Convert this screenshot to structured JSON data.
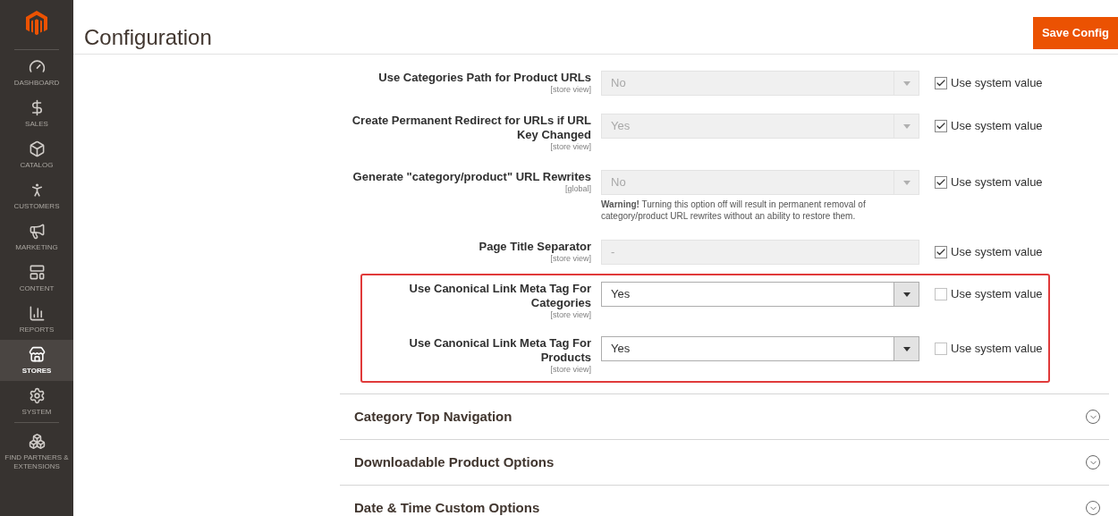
{
  "sidebar": {
    "items": [
      {
        "label": "DASHBOARD",
        "selected": false
      },
      {
        "label": "SALES",
        "selected": false
      },
      {
        "label": "CATALOG",
        "selected": false
      },
      {
        "label": "CUSTOMERS",
        "selected": false
      },
      {
        "label": "MARKETING",
        "selected": false
      },
      {
        "label": "CONTENT",
        "selected": false
      },
      {
        "label": "REPORTS",
        "selected": false
      },
      {
        "label": "STORES",
        "selected": true
      },
      {
        "label": "SYSTEM",
        "selected": false
      },
      {
        "label": "FIND PARTNERS & EXTENSIONS",
        "selected": false
      }
    ]
  },
  "header": {
    "title": "Configuration",
    "button": "Save Config"
  },
  "fields": [
    {
      "label": "Use Categories Path for Product URLs",
      "scope": "[store view]",
      "kind": "select",
      "value": "No",
      "use_system_value": true,
      "system_label": "Use system value",
      "highlighted": false
    },
    {
      "label": "Create Permanent Redirect for URLs if URL Key Changed",
      "scope": "[store view]",
      "kind": "select",
      "value": "Yes",
      "use_system_value": true,
      "system_label": "Use system value",
      "highlighted": false
    },
    {
      "label": "Generate \"category/product\" URL Rewrites",
      "scope": "[global]",
      "kind": "select",
      "value": "No",
      "use_system_value": true,
      "system_label": "Use system value",
      "highlighted": false,
      "note": "**Warning!** Turning this option off will result in permanent removal of category/product URL rewrites without an ability to restore them."
    },
    {
      "label": "Page Title Separator",
      "scope": "[store view]",
      "kind": "text",
      "value": "-",
      "use_system_value": true,
      "system_label": "Use system value",
      "highlighted": false
    },
    {
      "label": "Use Canonical Link Meta Tag For Categories",
      "scope": "[store view]",
      "kind": "select",
      "value": "Yes",
      "use_system_value": false,
      "system_label": "Use system value",
      "highlighted": true
    },
    {
      "label": "Use Canonical Link Meta Tag For Products",
      "scope": "[store view]",
      "kind": "select",
      "value": "Yes",
      "use_system_value": false,
      "system_label": "Use system value",
      "highlighted": true
    }
  ],
  "sections": [
    {
      "title": "Category Top Navigation",
      "expanded": false
    },
    {
      "title": "Downloadable Product Options",
      "expanded": false
    },
    {
      "title": "Date & Time Custom Options",
      "expanded": false
    }
  ]
}
